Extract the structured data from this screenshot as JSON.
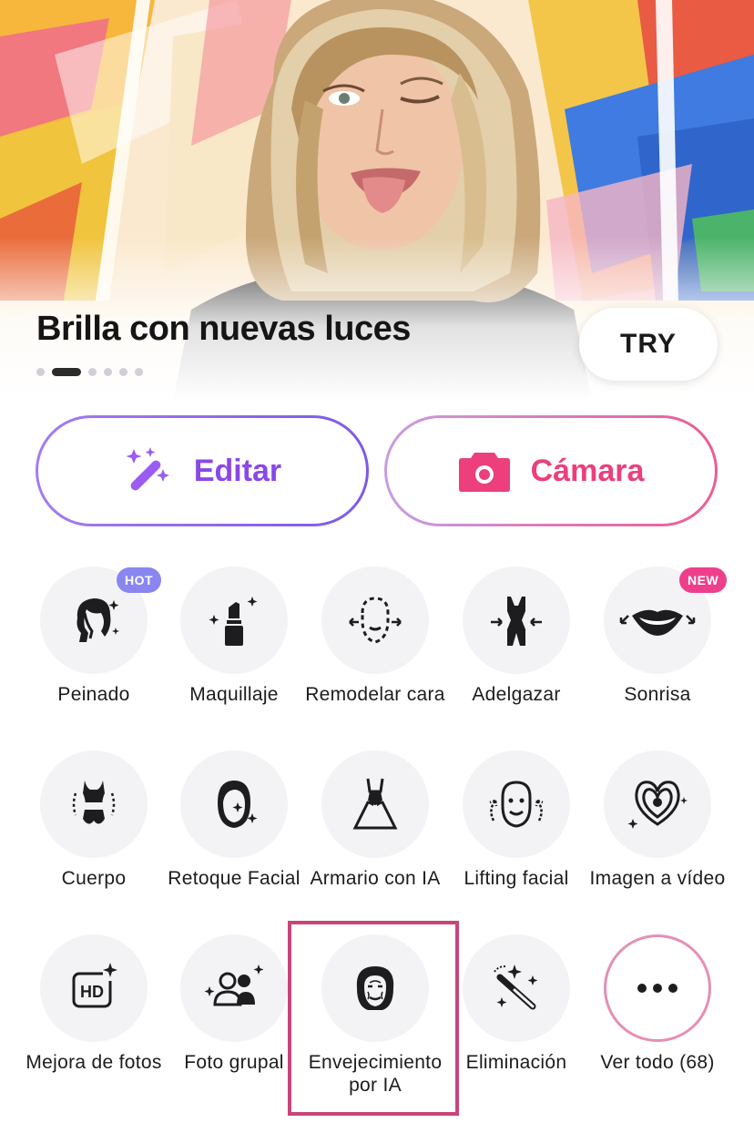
{
  "hero": {
    "title": "Brilla con nuevas luces",
    "try_label": "TRY",
    "page_count": 6,
    "active_page": 2
  },
  "actions": {
    "edit_label": "Editar",
    "camera_label": "Cámara"
  },
  "tools": [
    {
      "label": "Peinado",
      "icon": "hairstyle-icon",
      "badge": "HOT"
    },
    {
      "label": "Maquillaje",
      "icon": "lipstick-icon"
    },
    {
      "label": "Remodelar cara",
      "icon": "face-reshape-icon"
    },
    {
      "label": "Adelgazar",
      "icon": "slim-body-icon"
    },
    {
      "label": "Sonrisa",
      "icon": "smile-lips-icon",
      "badge": "NEW"
    },
    {
      "label": "Cuerpo",
      "icon": "body-icon"
    },
    {
      "label": "Retoque Facial",
      "icon": "face-retouch-icon"
    },
    {
      "label": "Armario con IA",
      "icon": "dress-icon"
    },
    {
      "label": "Lifting facial",
      "icon": "face-lift-icon"
    },
    {
      "label": "Imagen a vídeo",
      "icon": "image-to-video-icon"
    },
    {
      "label": "Mejora de fotos",
      "icon": "hd-enhance-icon"
    },
    {
      "label": "Foto grupal",
      "icon": "group-photo-icon"
    },
    {
      "label": "Envejecimiento por IA",
      "icon": "aging-icon"
    },
    {
      "label": "Eliminación",
      "icon": "eraser-wand-icon"
    },
    {
      "label": "Ver todo (68)",
      "icon": "more-dots-icon"
    }
  ],
  "colors": {
    "edit_accent": "#8a48e8",
    "camera_accent": "#ec3f7c",
    "hot_badge": "#8a86f0",
    "new_badge": "#ee3f8c",
    "highlight": "#c8457a"
  }
}
